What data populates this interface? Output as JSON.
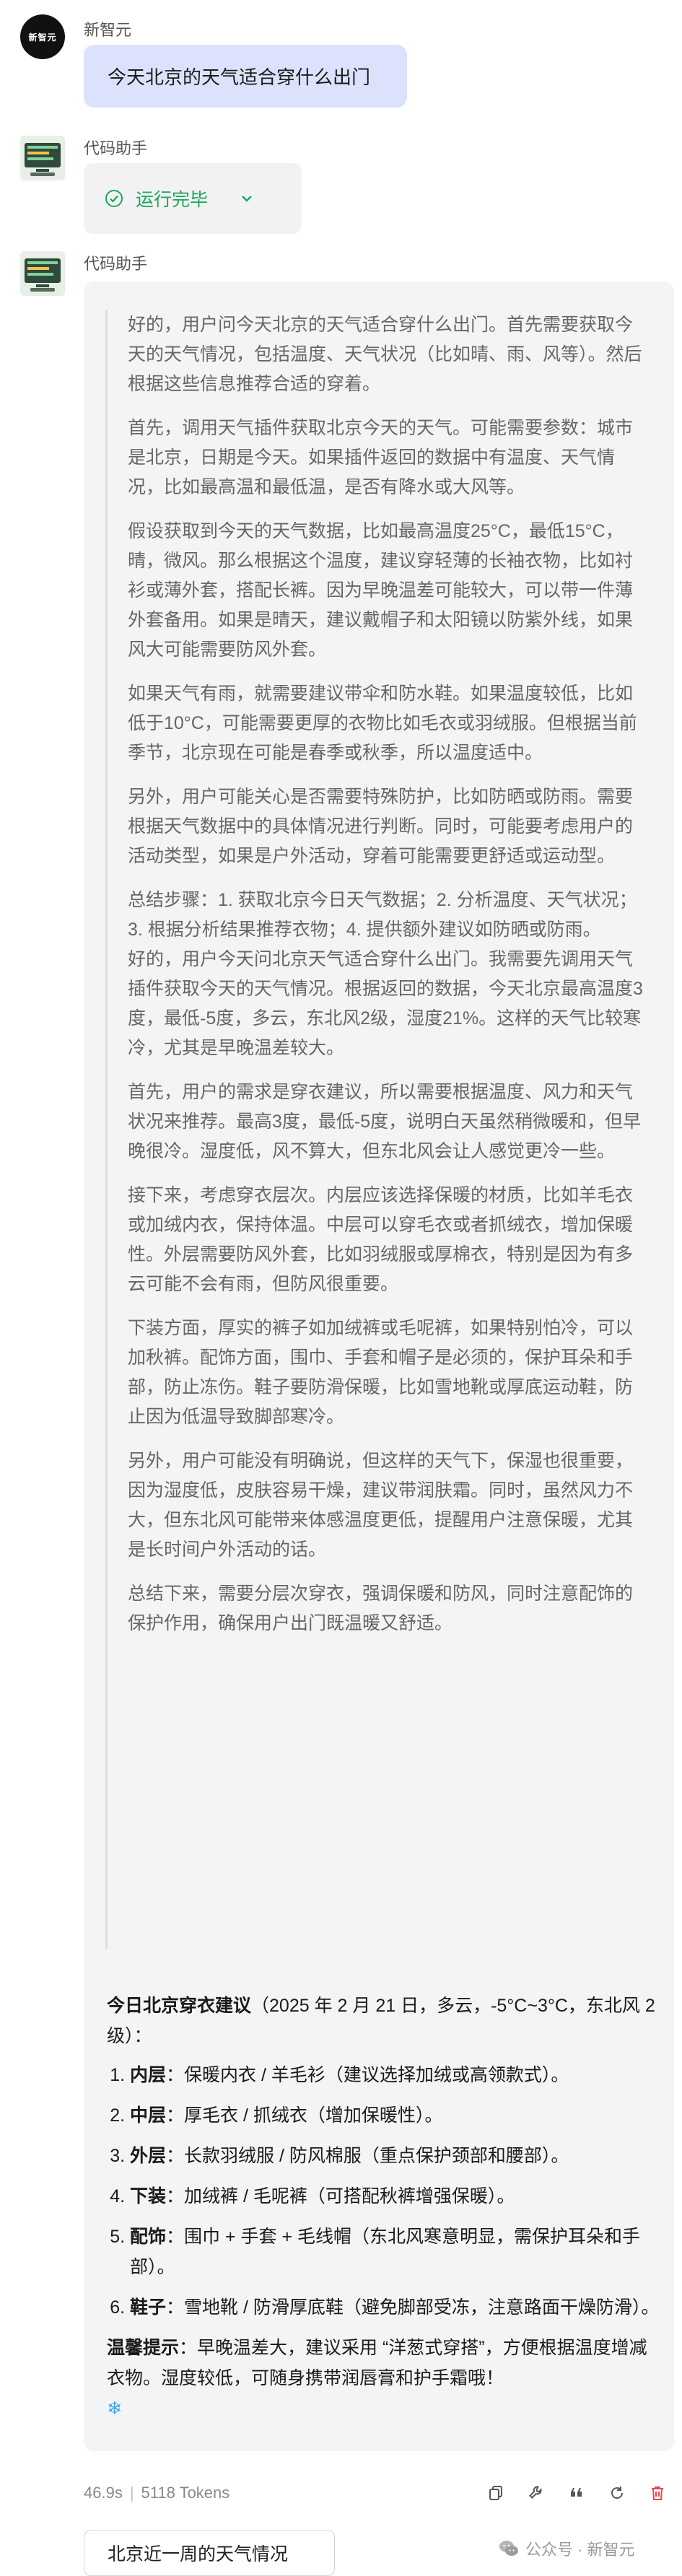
{
  "user": {
    "name": "新智元",
    "avatar_text": "新智元",
    "message": "今天北京的天气适合穿什么出门"
  },
  "status": {
    "sender": "代码助手",
    "label": "运行完毕"
  },
  "answer": {
    "sender": "代码助手",
    "thinking": [
      "好的，用户问今天北京的天气适合穿什么出门。首先需要获取今天的天气情况，包括温度、天气状况（比如晴、雨、风等）。然后根据这些信息推荐合适的穿着。",
      "首先，调用天气插件获取北京今天的天气。可能需要参数：城市是北京，日期是今天。如果插件返回的数据中有温度、天气情况，比如最高温和最低温，是否有降水或大风等。",
      "假设获取到今天的天气数据，比如最高温度25°C，最低15°C，晴，微风。那么根据这个温度，建议穿轻薄的长袖衣物，比如衬衫或薄外套，搭配长裤。因为早晚温差可能较大，可以带一件薄外套备用。如果是晴天，建议戴帽子和太阳镜以防紫外线，如果风大可能需要防风外套。",
      "如果天气有雨，就需要建议带伞和防水鞋。如果温度较低，比如低于10°C，可能需要更厚的衣物比如毛衣或羽绒服。但根据当前季节，北京现在可能是春季或秋季，所以温度适中。",
      "另外，用户可能关心是否需要特殊防护，比如防晒或防雨。需要根据天气数据中的具体情况进行判断。同时，可能要考虑用户的活动类型，如果是户外活动，穿着可能需要更舒适或运动型。",
      "总结步骤：1. 获取北京今日天气数据；2. 分析温度、天气状况；3. 根据分析结果推荐衣物；4. 提供额外建议如防晒或防雨。",
      "好的，用户今天问北京天气适合穿什么出门。我需要先调用天气插件获取今天的天气情况。根据返回的数据，今天北京最高温度3度，最低-5度，多云，东北风2级，湿度21%。这样的天气比较寒冷，尤其是早晚温差较大。",
      "首先，用户的需求是穿衣建议，所以需要根据温度、风力和天气状况来推荐。最高3度，最低-5度，说明白天虽然稍微暖和，但早晚很冷。湿度低，风不算大，但东北风会让人感觉更冷一些。",
      "接下来，考虑穿衣层次。内层应该选择保暖的材质，比如羊毛衣或加绒内衣，保持体温。中层可以穿毛衣或者抓绒衣，增加保暖性。外层需要防风外套，比如羽绒服或厚棉衣，特别是因为有多云可能不会有雨，但防风很重要。",
      "下装方面，厚实的裤子如加绒裤或毛呢裤，如果特别怕冷，可以加秋裤。配饰方面，围巾、手套和帽子是必须的，保护耳朵和手部，防止冻伤。鞋子要防滑保暖，比如雪地靴或厚底运动鞋，防止因为低温导致脚部寒冷。",
      "另外，用户可能没有明确说，但这样的天气下，保湿也很重要，因为湿度低，皮肤容易干燥，建议带润肤霜。同时，虽然风力不大，但东北风可能带来体感温度更低，提醒用户注意保暖，尤其是长时间户外活动的话。",
      "总结下来，需要分层次穿衣，强调保暖和防风，同时注意配饰的保护作用，确保用户出门既温暖又舒适。"
    ],
    "final_title": "今日北京穿衣建议",
    "final_meta": "（2025 年 2 月 21 日，多云，-5°C~3°C，东北风 2 级）：",
    "items": [
      {
        "label": "内层",
        "text": "：保暖内衣 / 羊毛衫（建议选择加绒或高领款式）。"
      },
      {
        "label": "中层",
        "text": "：厚毛衣 / 抓绒衣（增加保暖性）。"
      },
      {
        "label": "外层",
        "text": "：长款羽绒服 / 防风棉服（重点保护颈部和腰部）。"
      },
      {
        "label": "下装",
        "text": "：加绒裤 / 毛呢裤（可搭配秋裤增强保暖）。"
      },
      {
        "label": "配饰",
        "text": "：围巾 + 手套 + 毛线帽（东北风寒意明显，需保护耳朵和手部）。"
      },
      {
        "label": "鞋子",
        "text": "：雪地靴 / 防滑厚底鞋（避免脚部受冻，注意路面干燥防滑）。"
      }
    ],
    "tip_label": "温馨提示",
    "tip_text": "：早晚温差大，建议采用 “洋葱式穿搭”，方便根据温度增减衣物。湿度较低，可随身携带润唇膏和护手霜哦！",
    "tip_emoji": "❄"
  },
  "meta": {
    "time": "46.9s",
    "tokens": "5118 Tokens"
  },
  "actions": [
    "copy-icon",
    "tool-icon",
    "quote-icon",
    "refresh-icon",
    "delete-icon"
  ],
  "colors": {
    "accent_green": "#19a85b",
    "user_bubble": "#dde2fc",
    "delete_red": "#e5484d"
  },
  "suggestion": "北京近一周的天气情况",
  "watermark": "公众号 · 新智元"
}
